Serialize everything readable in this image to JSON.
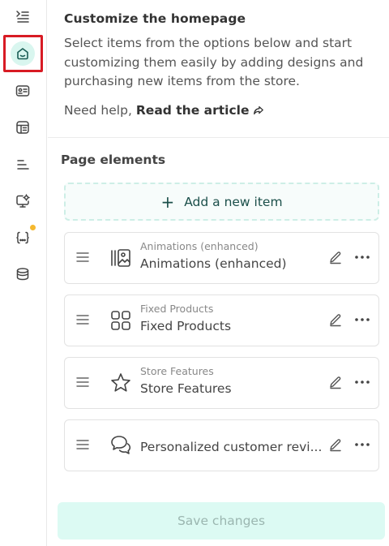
{
  "rail": {
    "items": [
      {
        "icon": "collapse-menu-icon"
      },
      {
        "icon": "home-icon"
      },
      {
        "icon": "id-card-icon"
      },
      {
        "icon": "layout-icon"
      },
      {
        "icon": "align-lines-icon"
      },
      {
        "icon": "settings-monitor-icon"
      },
      {
        "icon": "code-braces-icon",
        "badge": true
      },
      {
        "icon": "database-box-icon"
      }
    ]
  },
  "intro": {
    "title": "Customize the homepage",
    "description": "Select items from the options below and start customizing them easily by adding designs and purchasing new items from the store.",
    "help_prefix": "Need help,",
    "help_link": "Read the article"
  },
  "page_elements": {
    "title": "Page elements",
    "add_label": "Add a new item",
    "items": [
      {
        "subtitle": "Animations (enhanced)",
        "title": "Animations (enhanced)",
        "icon": "gallery-icon"
      },
      {
        "subtitle": "Fixed Products",
        "title": "Fixed Products",
        "icon": "grid-squares-icon"
      },
      {
        "subtitle": "Store Features",
        "title": "Store Features",
        "icon": "star-icon"
      },
      {
        "subtitle": "",
        "title": "Personalized customer revi...",
        "icon": "chat-bubbles-icon"
      }
    ]
  },
  "actions": {
    "save_label": "Save changes"
  }
}
